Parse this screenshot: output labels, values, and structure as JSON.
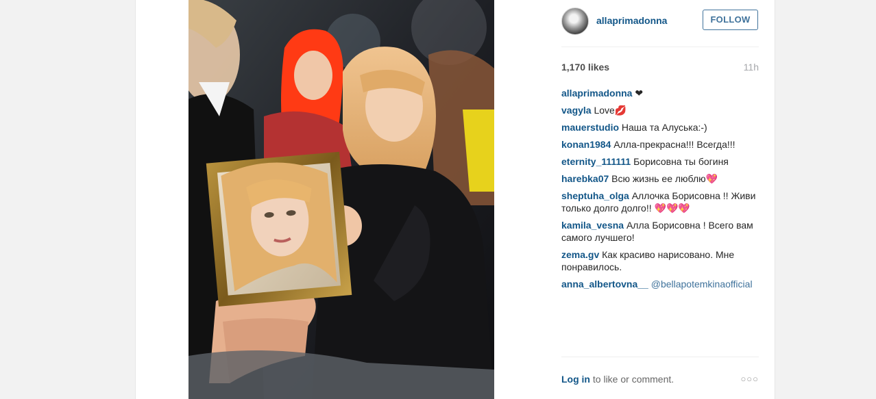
{
  "post": {
    "owner": "allaprimadonna",
    "follow_label": "FOLLOW",
    "likes": "1,170 likes",
    "time": "11h"
  },
  "comments": [
    {
      "user": "allaprimadonna",
      "text": "❤"
    },
    {
      "user": "vagyla",
      "text": "Love💋"
    },
    {
      "user": "mauerstudio",
      "text": "Наша та Алуська:-)"
    },
    {
      "user": "konan1984",
      "text": "Алла-прекрасна!!! Всегда!!!"
    },
    {
      "user": "eternity_111111",
      "text": "Борисовна ты богиня"
    },
    {
      "user": "harebka07",
      "text": "Всю жизнь ее люблю💖"
    },
    {
      "user": "sheptuha_olga",
      "text": "Аллочка Борисовна !! Живи только долго долго!! 💖💖💖"
    },
    {
      "user": "kamila_vesna",
      "text": "Алла Борисовна ! Всего вам самого лучшего!"
    },
    {
      "user": "zema.gv",
      "text": "Как красиво нарисовано. Мне понравилось."
    },
    {
      "user": "anna_albertovna__",
      "text": "",
      "mention": "@bellapotemkinaofficial"
    }
  ],
  "footer": {
    "login_label": "Log in",
    "rest": " to like or comment.",
    "more_label": "○○○"
  },
  "colors": {
    "link": "#125688",
    "follow": "#3f729b",
    "text": "#262626",
    "muted": "#a5a7aa"
  },
  "icons": {
    "avatar": "avatar-image",
    "more": "more-options-icon"
  }
}
